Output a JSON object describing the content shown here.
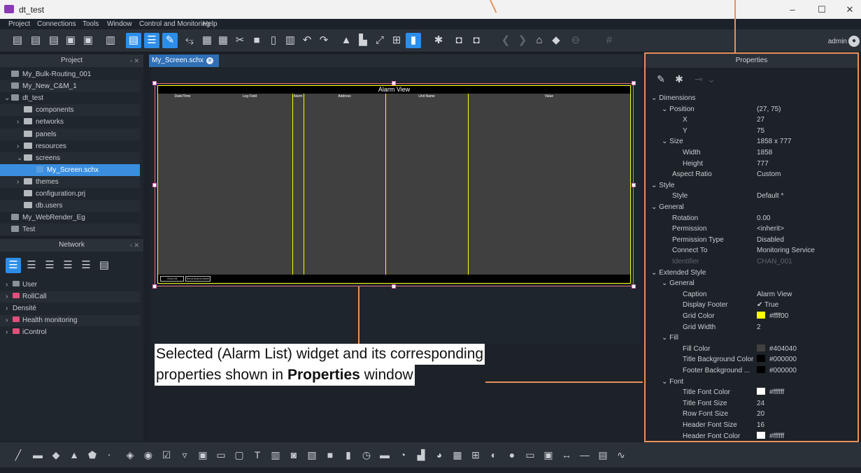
{
  "window": {
    "title": "dt_test",
    "controls": [
      "–",
      "☐",
      "✕"
    ]
  },
  "menu": [
    "Project",
    "Connections",
    "Tools",
    "Window",
    "Control and Monitoring",
    "Help"
  ],
  "toolbar": {
    "user": "admin"
  },
  "project_panel": {
    "title": "Project",
    "items": [
      {
        "label": "My_Bulk-Routing_001",
        "depth": 0,
        "kind": "proj"
      },
      {
        "label": "My_New_C&M_1",
        "depth": 0,
        "kind": "proj"
      },
      {
        "label": "dt_test",
        "depth": 0,
        "kind": "proj",
        "expanded": true
      },
      {
        "label": "components",
        "depth": 1,
        "kind": "folder"
      },
      {
        "label": "networks",
        "depth": 1,
        "kind": "folder",
        "collapsed": true
      },
      {
        "label": "panels",
        "depth": 1,
        "kind": "folder"
      },
      {
        "label": "resources",
        "depth": 1,
        "kind": "folder",
        "collapsed": true
      },
      {
        "label": "screens",
        "depth": 1,
        "kind": "folder",
        "expanded": true
      },
      {
        "label": "My_Screen.schx",
        "depth": 2,
        "kind": "file",
        "selected": true
      },
      {
        "label": "themes",
        "depth": 1,
        "kind": "folder",
        "collapsed": true
      },
      {
        "label": "configuration.prj",
        "depth": 1,
        "kind": "doc"
      },
      {
        "label": "db.users",
        "depth": 1,
        "kind": "users"
      },
      {
        "label": "My_WebRender_Eg",
        "depth": 0,
        "kind": "proj"
      },
      {
        "label": "Test",
        "depth": 0,
        "kind": "proj"
      }
    ]
  },
  "network_panel": {
    "title": "Network",
    "items": [
      {
        "label": "User",
        "color": "#8a9198"
      },
      {
        "label": "RollCall",
        "color": "#e0507a"
      },
      {
        "label": "Densité",
        "color": ""
      },
      {
        "label": "Health monitoring",
        "color": "#e0507a"
      },
      {
        "label": "iControl",
        "color": "#e0507a"
      }
    ]
  },
  "editor": {
    "tab_label": "My_Screen.schx",
    "widget": {
      "title": "Alarm View",
      "columns": [
        "Date/Time",
        "Log Field",
        "Alarm",
        "Address",
        "Unit Name",
        "Value"
      ],
      "footer_buttons": [
        "Clear All",
        "Send Acked Alarm"
      ]
    }
  },
  "properties": {
    "title": "Properties",
    "rows": [
      {
        "key": "Dimensions",
        "val": "",
        "indent": 0,
        "expander": true
      },
      {
        "key": "Position",
        "val": "(27, 75)",
        "indent": 1,
        "expander": true
      },
      {
        "key": "X",
        "val": "27",
        "indent": 3
      },
      {
        "key": "Y",
        "val": "75",
        "indent": 3
      },
      {
        "key": "Size",
        "val": "1858 x 777",
        "indent": 1,
        "expander": true
      },
      {
        "key": "Width",
        "val": "1858",
        "indent": 3
      },
      {
        "key": "Height",
        "val": "777",
        "indent": 3
      },
      {
        "key": "Aspect Ratio",
        "val": "Custom",
        "indent": 2
      },
      {
        "key": "Style",
        "val": "",
        "indent": 0,
        "expander": true
      },
      {
        "key": "Style",
        "val": "Default *",
        "indent": 2
      },
      {
        "key": "General",
        "val": "",
        "indent": 0,
        "expander": true
      },
      {
        "key": "Rotation",
        "val": "0.00",
        "indent": 2
      },
      {
        "key": "Permission",
        "val": "<inherit>",
        "indent": 2
      },
      {
        "key": "Permission Type",
        "val": "Disabled",
        "indent": 2
      },
      {
        "key": "Connect To",
        "val": "Monitoring Service",
        "indent": 2
      },
      {
        "key": "Identifier",
        "val": "CHAN_001",
        "indent": 2,
        "dim": true
      },
      {
        "key": "Extended Style",
        "val": "",
        "indent": 0,
        "expander": true
      },
      {
        "key": "General",
        "val": "",
        "indent": 1,
        "expander": true
      },
      {
        "key": "Caption",
        "val": "Alarm View",
        "indent": 3
      },
      {
        "key": "Display Footer",
        "val": "✔ True",
        "indent": 3
      },
      {
        "key": "Grid Color",
        "val": "#ffff00",
        "indent": 3,
        "swatch": "#ffff00"
      },
      {
        "key": "Grid Width",
        "val": "2",
        "indent": 3
      },
      {
        "key": "Fill",
        "val": "",
        "indent": 1,
        "expander": true
      },
      {
        "key": "Fill Color",
        "val": "#404040",
        "indent": 3,
        "swatch": "#404040"
      },
      {
        "key": "Title Background Color",
        "val": "#000000",
        "indent": 3,
        "swatch": "#000000"
      },
      {
        "key": "Footer Background ...",
        "val": "#000000",
        "indent": 3,
        "swatch": "#000000"
      },
      {
        "key": "Font",
        "val": "",
        "indent": 1,
        "expander": true
      },
      {
        "key": "Title Font Color",
        "val": "#ffffff",
        "indent": 3,
        "swatch": "#ffffff"
      },
      {
        "key": "Title Font Size",
        "val": "24",
        "indent": 3
      },
      {
        "key": "Row Font Size",
        "val": "20",
        "indent": 3
      },
      {
        "key": "Header Font Size",
        "val": "16",
        "indent": 3
      },
      {
        "key": "Header Font Color",
        "val": "#ffffff",
        "indent": 3,
        "swatch": "#ffffff"
      }
    ]
  },
  "annotation": {
    "line1": "Selected (Alarm List) widget and its corresponding",
    "line2_pre": "properties shown in ",
    "line2_bold": "Properties",
    "line2_post": " window"
  },
  "colors": {
    "accent": "#2d8ee8",
    "callout": "#e8905a",
    "grid": "#ffff00"
  }
}
